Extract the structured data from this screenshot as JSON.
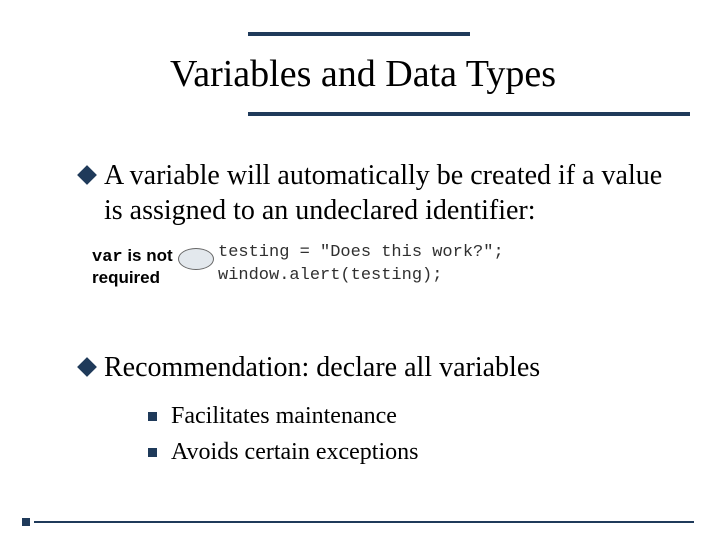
{
  "title": "Variables and Data Types",
  "bullets": {
    "b1": "A variable will automatically be created if a value is assigned to an undeclared identifier:",
    "b2": "Recommendation: declare all variables"
  },
  "callout": {
    "mono": "var",
    "rest_line1": " is not",
    "line2": "required"
  },
  "code": {
    "line1": "testing = \"Does this work?\";",
    "line2": "window.alert(testing);"
  },
  "sub": {
    "s1": "Facilitates maintenance",
    "s2": "Avoids certain exceptions"
  }
}
